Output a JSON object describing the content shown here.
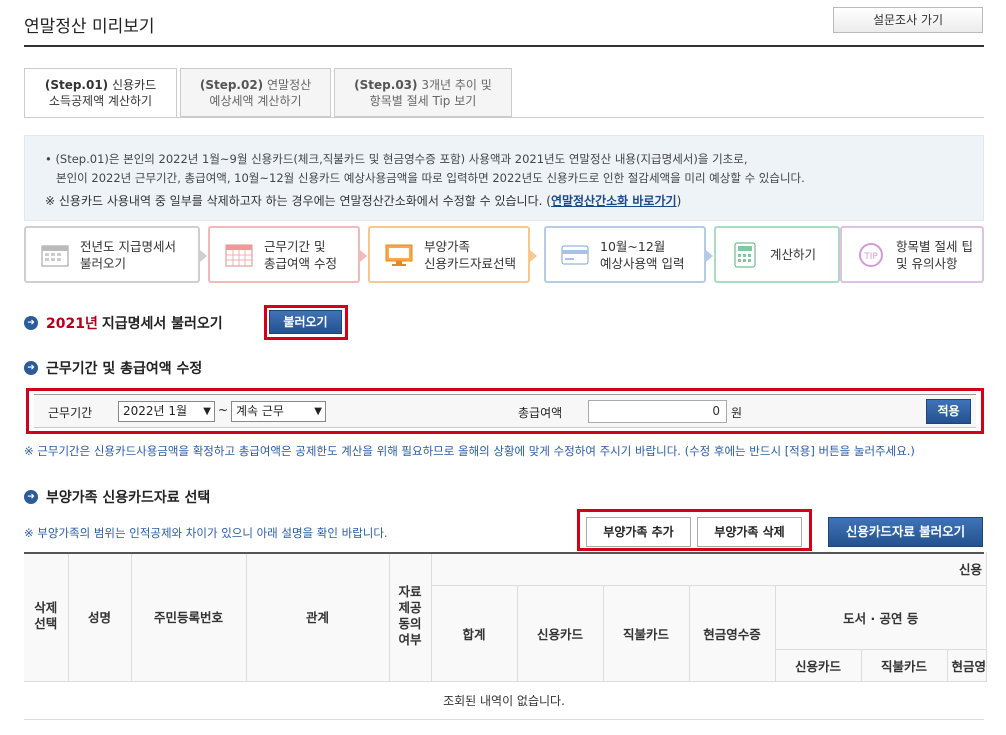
{
  "header": {
    "title": "연말정산 미리보기",
    "survey_button": "설문조사 가기"
  },
  "tabs": [
    {
      "step": "(Step.01)",
      "line1": "신용카드",
      "line2": "소득공제액 계산하기",
      "active": true
    },
    {
      "step": "(Step.02)",
      "line1": "연말정산",
      "line2": "예상세액 계산하기",
      "active": false
    },
    {
      "step": "(Step.03)",
      "line1": "3개년 추이 및",
      "line2": "항목별 절세 Tip 보기",
      "active": false
    }
  ],
  "info": {
    "line1": "• (Step.01)은 본인의 2022년 1월~9월 신용카드(체크,직불카드 및 현금영수증 포함) 사용액과 2021년도 연말정산 내용(지급명세서)을 기초로,",
    "line2": "본인이 2022년 근무기간, 총급여액, 10월~12월 신용카드 예상사용금액을 따로 입력하면 2022년도 신용카드로 인한 절감세액을 미리 예상할 수 있습니다.",
    "note_prefix": "※ 신용카드 사용내역 중 일부를 삭제하고자 하는 경우에는 연말정산간소화에서 수정할 수 있습니다. (",
    "note_link": "연말정산간소화 바로가기",
    "note_suffix": ")"
  },
  "steps": [
    {
      "line1": "전년도 지급명세서",
      "line2": "불러오기",
      "icon": "calendar-icon",
      "color": "#cfcfcf"
    },
    {
      "line1": "근무기간 및",
      "line2": "총급여액 수정",
      "icon": "grid-calendar-icon",
      "color": "#f1b9b9"
    },
    {
      "line1": "부양가족",
      "line2": "신용카드자료선택",
      "icon": "monitor-icon",
      "color": "#f4c88f"
    },
    {
      "line1": "10월~12월",
      "line2": "예상사용액 입력",
      "icon": "card-icon",
      "color": "#b8cbe6"
    },
    {
      "line1": "계산하기",
      "line2": "",
      "icon": "calculator-icon",
      "color": "#a9dcc0"
    },
    {
      "line1": "항목별 절세 팁",
      "line2": "및 유의사항",
      "icon": "tip-icon",
      "color": "#dcc3e6"
    }
  ],
  "section1": {
    "year": "2021년",
    "title": "지급명세서 불러오기",
    "button": "불러오기"
  },
  "section2": {
    "title": "근무기간 및 총급여액 수정",
    "period_label": "근무기간",
    "start_value": "2022년 1월",
    "tilde": "~",
    "end_value": "계속 근무",
    "salary_label": "총급여액",
    "salary_value": "0",
    "unit": "원",
    "apply_button": "적용",
    "notice": "※ 근무기간은 신용카드사용금액을 확정하고 총급여액은 공제한도 계산을 위해 필요하므로 올해의 상황에 맞게 수정하여 주시기 바랍니다. (수정 후에는 반드시 [적용] 버튼을 눌러주세요.)"
  },
  "section3": {
    "title": "부양가족 신용카드자료 선택",
    "notice": "※ 부양가족의 범위는 인적공제와 차이가 있으니 아래 설명을 확인 바랍니다.",
    "add_button": "부양가족 추가",
    "delete_button": "부양가족 삭제",
    "load_button": "신용카드자료 불러오기"
  },
  "table": {
    "col_delete": "삭제선택",
    "col_name": "성명",
    "col_rrn": "주민등록번호",
    "col_relation": "관계",
    "col_consent": "자료제공동의여부",
    "group_top": "신용",
    "col_total": "합계",
    "col_credit": "신용카드",
    "col_debit": "직불카드",
    "col_cash": "현금영수증",
    "group_books": "도서 · 공연 등",
    "sub_credit": "신용카드",
    "sub_debit": "직불카드",
    "sub_cash": "현금영",
    "empty_message": "조회된 내역이 없습니다."
  }
}
